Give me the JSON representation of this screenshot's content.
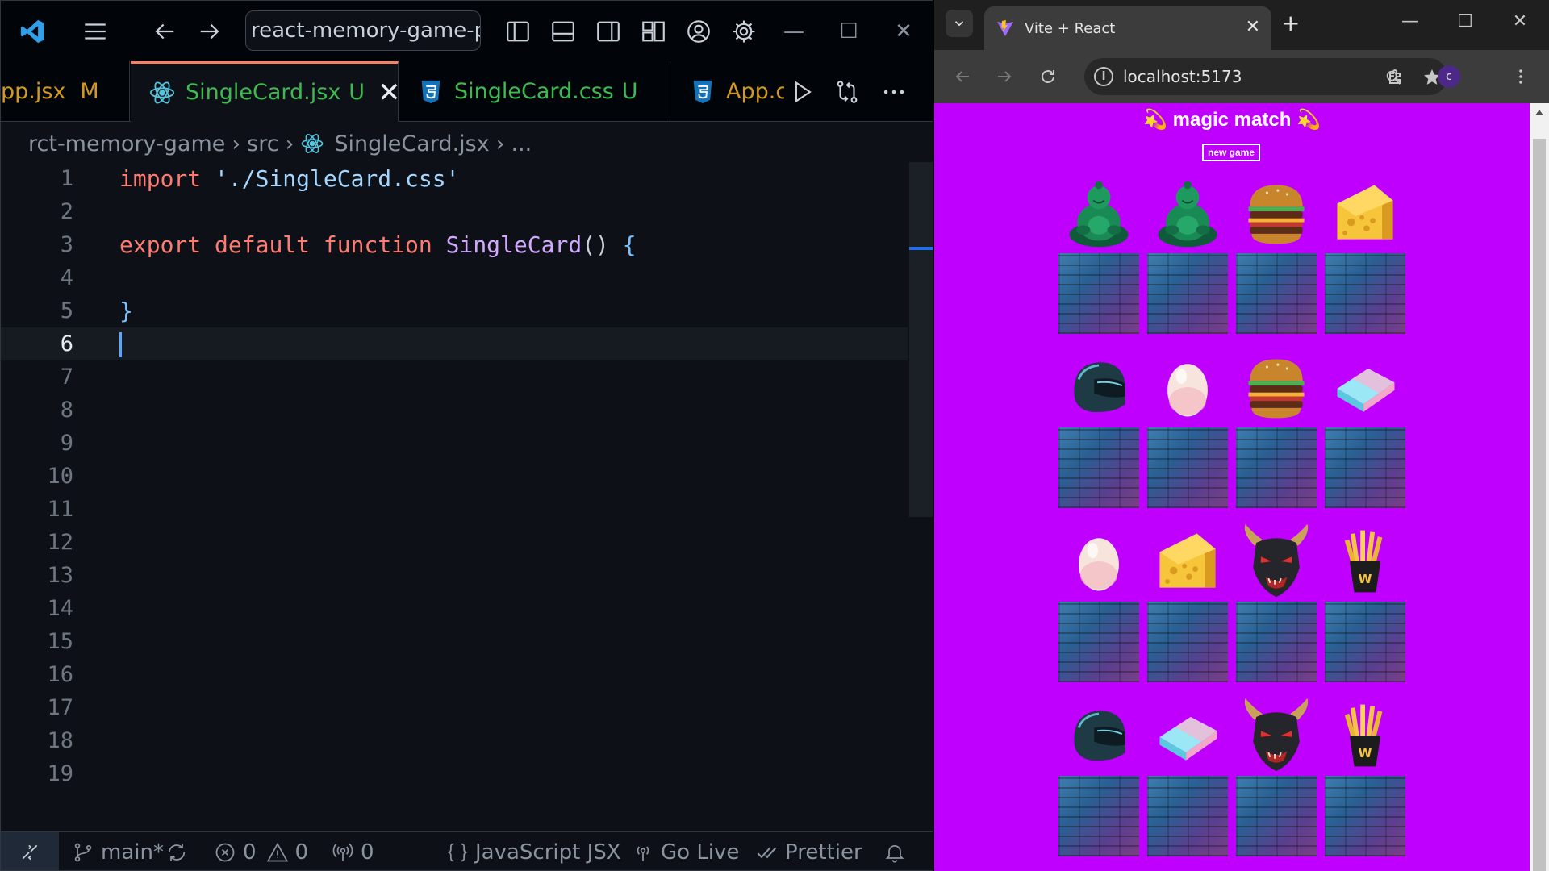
{
  "vscode": {
    "command_center": "react-memory-game-pro",
    "tabs": [
      {
        "name": "pp.jsx",
        "status": "M",
        "icon": "react-icon"
      },
      {
        "name": "SingleCard.jsx",
        "status": "U",
        "icon": "react-icon",
        "active": true
      },
      {
        "name": "SingleCard.css",
        "status": "U",
        "icon": "css-icon"
      },
      {
        "name": "App.c",
        "icon": "css-icon"
      }
    ],
    "breadcrumb": [
      "rct-memory-game",
      "src",
      "SingleCard.jsx",
      "..."
    ],
    "line_numbers": [
      "1",
      "2",
      "3",
      "4",
      "5",
      "6",
      "7",
      "8",
      "9",
      "10",
      "11",
      "12",
      "13",
      "14",
      "15",
      "16",
      "17",
      "18",
      "19"
    ],
    "current_line": 6,
    "code": {
      "l1_kw": "import",
      "l1_str": "'./SingleCard.css'",
      "l3_kw1": "export",
      "l3_kw2": "default",
      "l3_kw3": "function",
      "l3_fn": "SingleCard",
      "l3_paren": "()",
      "l3_brace": "{",
      "l5_brace": "}"
    },
    "status": {
      "branch": "main*",
      "errors": "0",
      "warnings": "0",
      "ports": "0",
      "language": "JavaScript JSX",
      "go_live": "Go Live",
      "formatter": "Prettier"
    }
  },
  "browser": {
    "tab_title": "Vite + React",
    "url": "localhost:5173",
    "profile_initial": "c",
    "page": {
      "title": "💫 magic match 💫",
      "new_game": "new game"
    },
    "cards": [
      [
        "buddha-icon",
        "buddha-icon",
        "burger-icon",
        "cheese-icon"
      ],
      [
        "helmet-icon",
        "egg-icon",
        "burger-icon",
        "eraser-icon"
      ],
      [
        "egg-icon",
        "cheese-icon",
        "demon-mask-icon",
        "fries-icon"
      ],
      [
        "helmet-icon",
        "eraser-icon",
        "demon-mask-icon",
        "fries-icon"
      ]
    ],
    "colors": {
      "page_background": "#bf00ff",
      "editor_background": "#0d1117"
    }
  }
}
